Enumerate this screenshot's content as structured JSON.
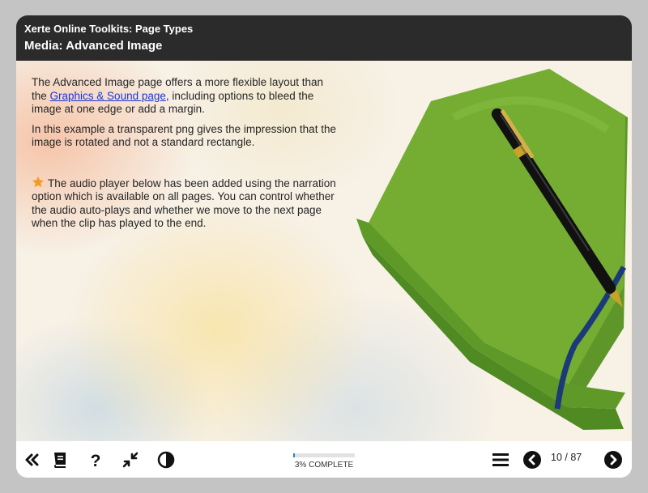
{
  "header": {
    "project_title": "Xerte Online Toolkits: Page Types",
    "page_title": "Media: Advanced Image"
  },
  "content": {
    "para1_before_link": "The Advanced Image page offers a more flexible layout than the ",
    "para1_link": "Graphics & Sound page",
    "para1_after_link": ", including options to bleed the image at one edge or add a margin.",
    "para2": "In this example a transparent png gives the impression that the image is rotated and not a standard rectangle.",
    "para3": "The audio player below has been added using the narration option which is available on all pages. You can control whether the audio auto-plays and whether we move to the next page when the clip has played to the end.",
    "star_icon": "star-icon",
    "image_subject": "green-folder-with-pen"
  },
  "footer": {
    "icons": [
      "double-chevron-left-icon",
      "book-icon",
      "help-icon",
      "collapse-arrows-icon",
      "contrast-icon",
      "menu-icon",
      "arrow-left-circle-icon",
      "arrow-right-circle-icon"
    ],
    "progress_label": "3% COMPLETE",
    "progress_fraction": 0.03,
    "page_indicator": "10 / 87"
  },
  "colors": {
    "header_bg": "#2b2b2b",
    "link": "#1a35d6",
    "star": "#f59a23",
    "progress_fill": "#2f7fd1",
    "folder_green": "#6fa52d"
  }
}
